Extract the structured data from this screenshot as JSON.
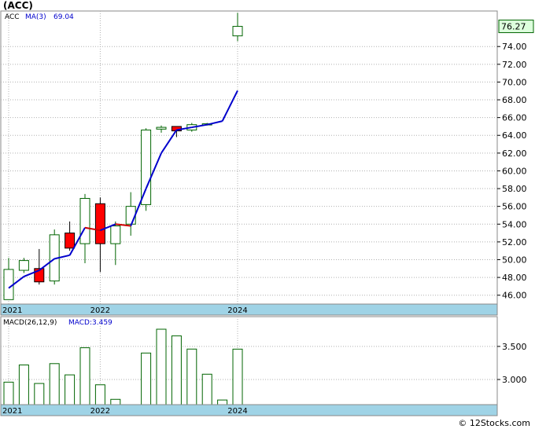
{
  "ticker_title": "(ACC)",
  "watermark": "© 12Stocks.com",
  "chart_data": [
    {
      "type": "candlestick",
      "title": "(ACC)",
      "legend": {
        "ticker": "ACC",
        "ma_label": "MA(3)",
        "ma_value": "69.04"
      },
      "last_price_label": "76.27",
      "ylim": [
        45,
        78
      ],
      "y_ticks": [
        46,
        48,
        50,
        52,
        54,
        56,
        58,
        60,
        62,
        64,
        66,
        68,
        70,
        72,
        74
      ],
      "y_tick_labels": [
        "46.00",
        "48.00",
        "50.00",
        "52.00",
        "54.00",
        "56.00",
        "58.00",
        "60.00",
        "62.00",
        "64.00",
        "66.00",
        "68.00",
        "70.00",
        "72.00",
        "74.00"
      ],
      "x_labels": [
        {
          "index": 0,
          "label": "2021"
        },
        {
          "index": 6,
          "label": "2022"
        },
        {
          "index": 15,
          "label": "2024"
        }
      ],
      "candles": [
        {
          "o": 45.5,
          "h": 50.2,
          "l": 45.5,
          "c": 48.9
        },
        {
          "o": 48.8,
          "h": 50.2,
          "l": 48.5,
          "c": 49.9
        },
        {
          "o": 49.0,
          "h": 51.2,
          "l": 47.2,
          "c": 47.5
        },
        {
          "o": 47.6,
          "h": 53.4,
          "l": 47.2,
          "c": 52.8
        },
        {
          "o": 53.0,
          "h": 54.3,
          "l": 51.0,
          "c": 51.3
        },
        {
          "o": 51.8,
          "h": 57.4,
          "l": 49.6,
          "c": 56.9
        },
        {
          "o": 56.3,
          "h": 57.0,
          "l": 48.6,
          "c": 51.8
        },
        {
          "o": 51.8,
          "h": 54.3,
          "l": 49.4,
          "c": 53.8
        },
        {
          "o": 54.0,
          "h": 57.6,
          "l": 52.7,
          "c": 56.0
        },
        {
          "o": 56.2,
          "h": 64.8,
          "l": 55.5,
          "c": 64.6
        },
        {
          "o": 64.7,
          "h": 65.1,
          "l": 64.3,
          "c": 64.9
        },
        {
          "o": 65.0,
          "h": 65.0,
          "l": 63.8,
          "c": 64.5
        },
        {
          "o": 64.6,
          "h": 65.4,
          "l": 64.4,
          "c": 65.2
        },
        {
          "o": 65.2,
          "h": 65.4,
          "l": 65.1,
          "c": 65.3
        },
        null,
        {
          "o": 75.2,
          "h": 77.8,
          "l": 74.6,
          "c": 76.27
        }
      ],
      "ma_series": [
        {
          "index": 0,
          "value": 46.8
        },
        {
          "index": 1,
          "value": 48.1
        },
        {
          "index": 2,
          "value": 48.8
        },
        {
          "index": 3,
          "value": 50.1
        },
        {
          "index": 4,
          "value": 50.5
        },
        {
          "index": 5,
          "value": 53.6
        },
        {
          "index": 6,
          "value": 53.3
        },
        {
          "index": 7,
          "value": 54.0
        },
        {
          "index": 8,
          "value": 53.8
        },
        {
          "index": 9,
          "value": 58.0
        },
        {
          "index": 10,
          "value": 62.0
        },
        {
          "index": 11,
          "value": 64.6
        },
        {
          "index": 12,
          "value": 64.9
        },
        {
          "index": 13,
          "value": 65.2
        },
        {
          "index": 14,
          "value": 65.6
        },
        {
          "index": 15,
          "value": 69.04
        }
      ],
      "colors": {
        "up": "#ffffff",
        "up_border": "#006400",
        "down": "#ff0000",
        "ma_up": "#0000cc",
        "ma_down": "#cc0000",
        "last_label_bg": "#ddffdd"
      }
    },
    {
      "type": "bar",
      "title": "MACD",
      "legend": {
        "label": "MACD(26,12,9)",
        "value_label": "MACD:3.459"
      },
      "ylim": [
        2.62,
        3.95
      ],
      "y_ticks": [
        3.0,
        3.5
      ],
      "y_tick_labels": [
        "3.000",
        "3.500"
      ],
      "x_labels": [
        {
          "index": 0,
          "label": "2021"
        },
        {
          "index": 6,
          "label": "2022"
        },
        {
          "index": 15,
          "label": "2024"
        }
      ],
      "values": [
        2.96,
        3.22,
        2.94,
        3.24,
        3.07,
        3.48,
        2.92,
        2.7,
        null,
        3.4,
        3.76,
        3.66,
        3.46,
        3.08,
        2.69,
        3.459
      ],
      "bar_color": "#006400"
    }
  ]
}
